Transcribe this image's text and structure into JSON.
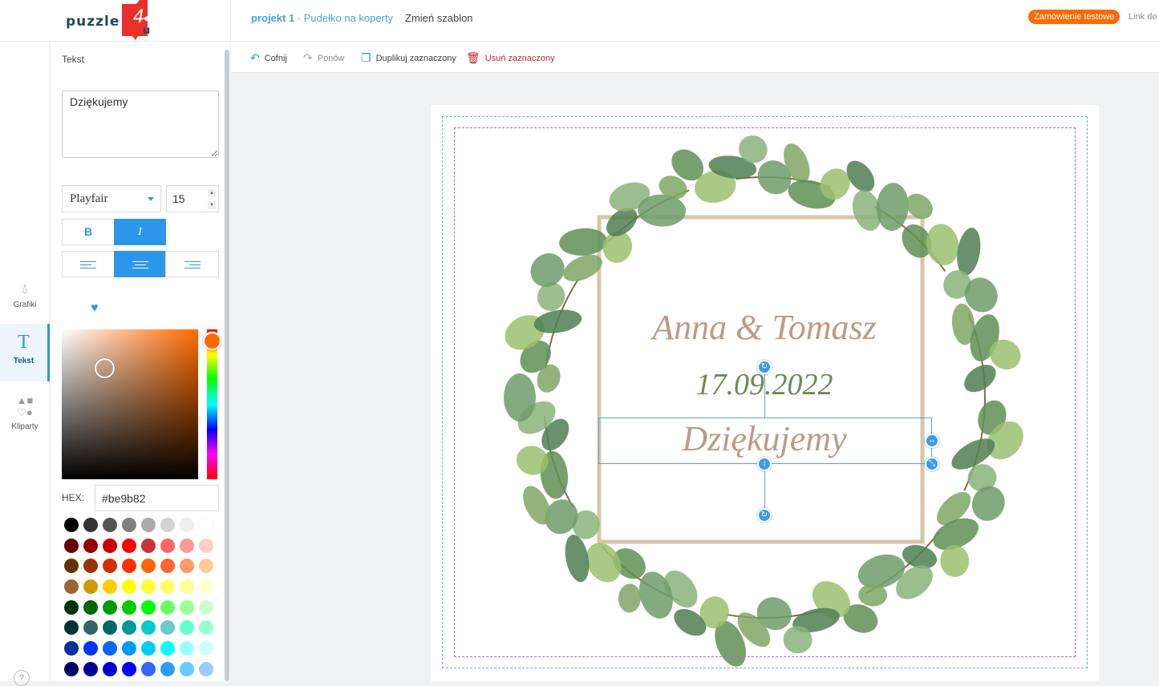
{
  "header": {
    "logo_text": "puzzle4u",
    "project": "projekt 1",
    "separator": " · ",
    "template": "Pudełko na koperty",
    "change_template": "Zmień szablon",
    "test_order": "Zamówienie testowe",
    "link": "Link do"
  },
  "rail": [
    {
      "label": "Grafiki",
      "icon": "drop-icon"
    },
    {
      "label": "Tekst",
      "icon": "text-icon",
      "glyph": "T"
    },
    {
      "label": "Kliparty",
      "icon": "shapes-icon"
    }
  ],
  "help": "?",
  "panel": {
    "title": "Tekst",
    "text_value": "Dziękujemy",
    "font": "Playfair",
    "size": "15",
    "bold": "B",
    "italic": "I",
    "hex_label": "HEX:",
    "hex_value": "#be9b82",
    "bold_active": false,
    "italic_active": true,
    "align": "center"
  },
  "toolbar": {
    "undo": "Cofnij",
    "redo": "Ponów",
    "duplicate": "Duplikuj zaznaczony",
    "delete": "Usuń zaznaczony"
  },
  "canvas": {
    "line1": "Anna & Tomasz",
    "line2": "17.09.2022",
    "line3": "Dziękujemy"
  },
  "colors": {
    "accent": "#2e96e8",
    "order": "#ff6a00",
    "text_rose": "#be9b82",
    "text_green": "#6d8a55",
    "delete": "#c0282d"
  },
  "swatches": [
    "#000000",
    "#333333",
    "#555555",
    "#808080",
    "#aaaaaa",
    "#d3d3d3",
    "#eeeeee",
    "#ffffff",
    "#660000",
    "#990000",
    "#cc0000",
    "#ff0000",
    "#cc3333",
    "#ff6666",
    "#ff9999",
    "#ffcccc",
    "#663300",
    "#993300",
    "#cc3300",
    "#ff3300",
    "#ff6600",
    "#ff6633",
    "#ff9966",
    "#ffcc99",
    "#996633",
    "#cc9900",
    "#ffcc00",
    "#ffff00",
    "#ffff33",
    "#ffff66",
    "#ffff99",
    "#ffffcc",
    "#003300",
    "#006600",
    "#009900",
    "#00cc00",
    "#00ff00",
    "#66ff66",
    "#99ff99",
    "#ccffcc",
    "#003333",
    "#336666",
    "#006666",
    "#009999",
    "#00cccc",
    "#66cccc",
    "#66ffcc",
    "#99ffcc",
    "#003399",
    "#0033ff",
    "#0066ff",
    "#0099ff",
    "#00ccff",
    "#00ffff",
    "#99ffff",
    "#ccffff",
    "#000066",
    "#000099",
    "#0000cc",
    "#0000ff",
    "#3366ff",
    "#3399ff",
    "#66ccff",
    "#99ccff"
  ]
}
